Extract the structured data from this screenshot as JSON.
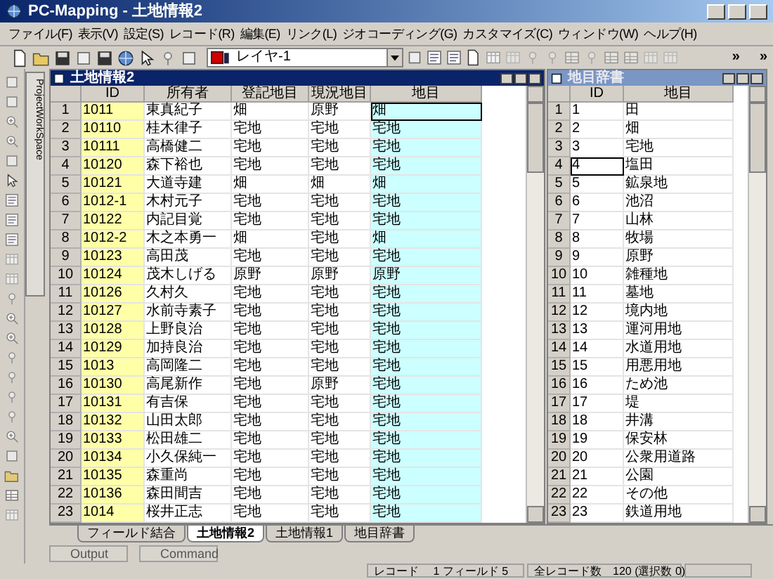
{
  "window": {
    "title": "PC-Mapping - 土地情報2"
  },
  "menu": [
    "ファイル(F)",
    "表示(V)",
    "設定(S)",
    "レコード(R)",
    "編集(E)",
    "リンク(L)",
    "ジオコーディング(G)",
    "カスタマイズ(C)",
    "ウィンドウ(W)",
    "ヘルプ(H)"
  ],
  "toolbar": {
    "layer": "レイヤ-1",
    "overflow": [
      "»",
      "»"
    ]
  },
  "side_tab": "ProjectWorkSpace",
  "tables": [
    {
      "title": "土地情報2",
      "active": true,
      "columns": [
        {
          "label": "ID",
          "color": "#ffffa8",
          "current": false
        },
        {
          "label": "所有者",
          "color": "#ffffff",
          "current": false
        },
        {
          "label": "登記地目",
          "color": "#ffffff",
          "current": false
        },
        {
          "label": "現況地目",
          "color": "#ffffff",
          "current": false
        },
        {
          "label": "地目",
          "color": "#ccffff",
          "current": true
        }
      ],
      "rows": [
        {
          "number": "1",
          "selected": true,
          "cells": [
            "1011",
            "東真紀子",
            "畑",
            "原野",
            "畑"
          ]
        },
        {
          "number": "2",
          "selected": false,
          "cells": [
            "10110",
            "桂木律子",
            "宅地",
            "宅地",
            "宅地"
          ]
        },
        {
          "number": "3",
          "selected": false,
          "cells": [
            "10111",
            "高橋健二",
            "宅地",
            "宅地",
            "宅地"
          ]
        },
        {
          "number": "4",
          "selected": false,
          "cells": [
            "10120",
            "森下裕也",
            "宅地",
            "宅地",
            "宅地"
          ]
        },
        {
          "number": "5",
          "selected": false,
          "cells": [
            "10121",
            "大道寺建",
            "畑",
            "畑",
            "畑"
          ]
        },
        {
          "number": "6",
          "selected": false,
          "cells": [
            "1012-1",
            "木村元子",
            "宅地",
            "宅地",
            "宅地"
          ]
        },
        {
          "number": "7",
          "selected": false,
          "cells": [
            "10122",
            "内記目覚",
            "宅地",
            "宅地",
            "宅地"
          ]
        },
        {
          "number": "8",
          "selected": false,
          "cells": [
            "1012-2",
            "木之本勇一",
            "畑",
            "宅地",
            "畑"
          ]
        },
        {
          "number": "9",
          "selected": false,
          "cells": [
            "10123",
            "高田茂",
            "宅地",
            "宅地",
            "宅地"
          ]
        },
        {
          "number": "10",
          "selected": false,
          "cells": [
            "10124",
            "茂木しげる",
            "原野",
            "原野",
            "原野"
          ]
        },
        {
          "number": "11",
          "selected": false,
          "cells": [
            "10126",
            "久村久",
            "宅地",
            "宅地",
            "宅地"
          ]
        },
        {
          "number": "12",
          "selected": false,
          "cells": [
            "10127",
            "水前寺素子",
            "宅地",
            "宅地",
            "宅地"
          ]
        },
        {
          "number": "13",
          "selected": false,
          "cells": [
            "10128",
            "上野良治",
            "宅地",
            "宅地",
            "宅地"
          ]
        },
        {
          "number": "14",
          "selected": false,
          "cells": [
            "10129",
            "加持良治",
            "宅地",
            "宅地",
            "宅地"
          ]
        },
        {
          "number": "15",
          "selected": false,
          "cells": [
            "1013",
            "高岡隆二",
            "宅地",
            "宅地",
            "宅地"
          ]
        },
        {
          "number": "16",
          "selected": false,
          "cells": [
            "10130",
            "高尾新作",
            "宅地",
            "原野",
            "宅地"
          ]
        },
        {
          "number": "17",
          "selected": false,
          "cells": [
            "10131",
            "有吉保",
            "宅地",
            "宅地",
            "宅地"
          ]
        },
        {
          "number": "18",
          "selected": false,
          "cells": [
            "10132",
            "山田太郎",
            "宅地",
            "宅地",
            "宅地"
          ]
        },
        {
          "number": "19",
          "selected": false,
          "cells": [
            "10133",
            "松田雄二",
            "宅地",
            "宅地",
            "宅地"
          ]
        },
        {
          "number": "20",
          "selected": false,
          "cells": [
            "10134",
            "小久保純一",
            "宅地",
            "宅地",
            "宅地"
          ]
        },
        {
          "number": "21",
          "selected": false,
          "cells": [
            "10135",
            "森重尚",
            "宅地",
            "宅地",
            "宅地"
          ]
        },
        {
          "number": "22",
          "selected": false,
          "cells": [
            "10136",
            "森田間吉",
            "宅地",
            "宅地",
            "宅地"
          ]
        },
        {
          "number": "23",
          "selected": false,
          "cells": [
            "1014",
            "桜井正志",
            "宅地",
            "宅地",
            "宅地"
          ]
        }
      ]
    },
    {
      "title": "地目辞書",
      "active": false,
      "columns": [
        {
          "label": "ID",
          "color": "#ffffff",
          "current": true
        },
        {
          "label": "地目",
          "color": "#ffffff",
          "current": false
        }
      ],
      "rows": [
        {
          "number": "1",
          "selected": false,
          "cells": [
            "1",
            "田"
          ]
        },
        {
          "number": "2",
          "selected": false,
          "cells": [
            "2",
            "畑"
          ]
        },
        {
          "number": "3",
          "selected": false,
          "cells": [
            "3",
            "宅地"
          ]
        },
        {
          "number": "4",
          "selected": true,
          "cells": [
            "4",
            "塩田"
          ]
        },
        {
          "number": "5",
          "selected": false,
          "cells": [
            "5",
            "鉱泉地"
          ]
        },
        {
          "number": "6",
          "selected": false,
          "cells": [
            "6",
            "池沼"
          ]
        },
        {
          "number": "7",
          "selected": false,
          "cells": [
            "7",
            "山林"
          ]
        },
        {
          "number": "8",
          "selected": false,
          "cells": [
            "8",
            "牧場"
          ]
        },
        {
          "number": "9",
          "selected": false,
          "cells": [
            "9",
            "原野"
          ]
        },
        {
          "number": "10",
          "selected": false,
          "cells": [
            "10",
            "雑種地"
          ]
        },
        {
          "number": "11",
          "selected": false,
          "cells": [
            "11",
            "墓地"
          ]
        },
        {
          "number": "12",
          "selected": false,
          "cells": [
            "12",
            "境内地"
          ]
        },
        {
          "number": "13",
          "selected": false,
          "cells": [
            "13",
            "運河用地"
          ]
        },
        {
          "number": "14",
          "selected": false,
          "cells": [
            "14",
            "水道用地"
          ]
        },
        {
          "number": "15",
          "selected": false,
          "cells": [
            "15",
            "用悪用地"
          ]
        },
        {
          "number": "16",
          "selected": false,
          "cells": [
            "16",
            "ため池"
          ]
        },
        {
          "number": "17",
          "selected": false,
          "cells": [
            "17",
            "堤"
          ]
        },
        {
          "number": "18",
          "selected": false,
          "cells": [
            "18",
            "井溝"
          ]
        },
        {
          "number": "19",
          "selected": false,
          "cells": [
            "19",
            "保安林"
          ]
        },
        {
          "number": "20",
          "selected": false,
          "cells": [
            "20",
            "公衆用道路"
          ]
        },
        {
          "number": "21",
          "selected": false,
          "cells": [
            "21",
            "公園"
          ]
        },
        {
          "number": "22",
          "selected": false,
          "cells": [
            "22",
            "その他"
          ]
        },
        {
          "number": "23",
          "selected": false,
          "cells": [
            "23",
            "鉄道用地"
          ]
        }
      ]
    }
  ],
  "sheet_tabs": [
    {
      "label": "フィールド結合",
      "selected": false
    },
    {
      "label": "土地情報2",
      "selected": true
    },
    {
      "label": "土地情報1",
      "selected": false
    },
    {
      "label": "地目辞書",
      "selected": false
    }
  ],
  "panel_tabs": [
    {
      "label": "Output",
      "selected": false
    },
    {
      "label": "Command",
      "selected": false
    }
  ],
  "status_bar": [
    "レコード　 1 フィールド 5",
    "全レコード数　120 (選択数 0)"
  ]
}
